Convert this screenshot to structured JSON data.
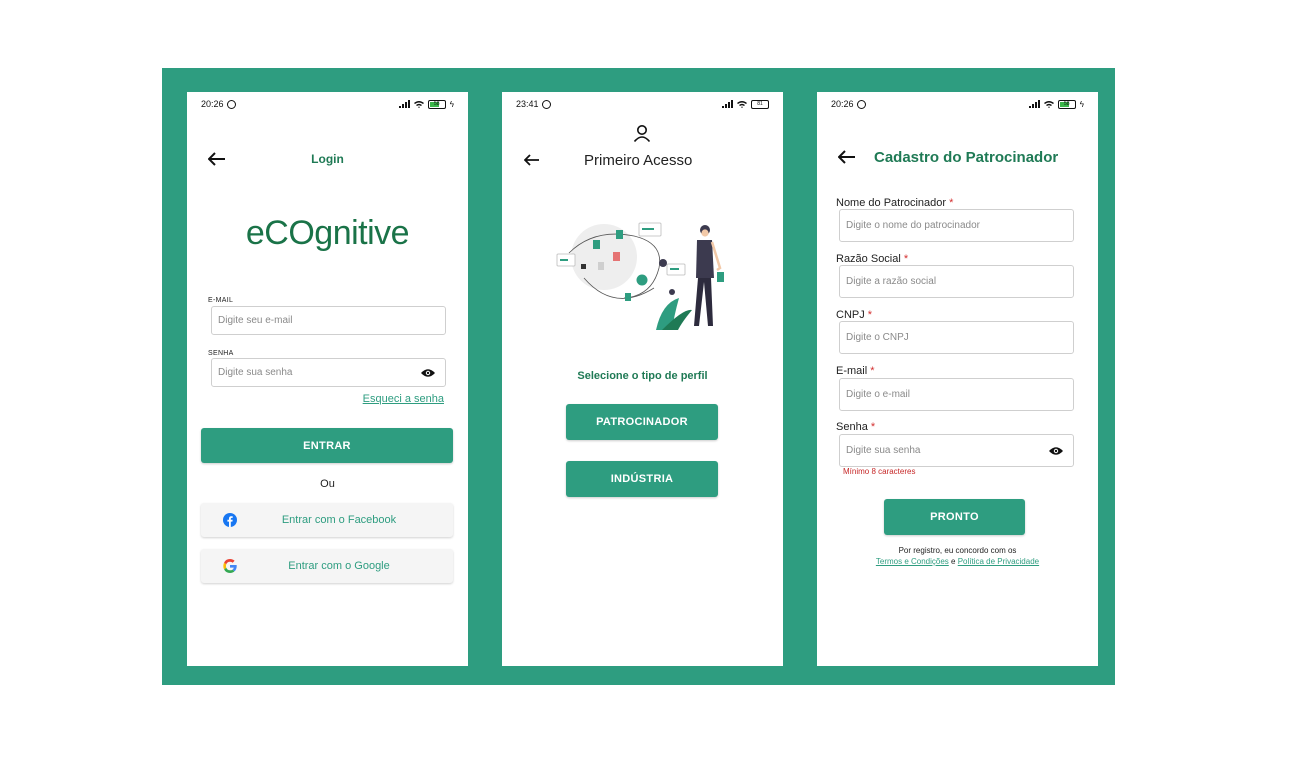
{
  "screens": [
    {
      "status": {
        "time": "20:26",
        "battery": "58"
      },
      "title": "Login",
      "logo": "eCOgnitive",
      "email": {
        "label": "E-MAIL",
        "placeholder": "Digite seu e-mail"
      },
      "password": {
        "label": "SENHA",
        "placeholder": "Digite sua senha"
      },
      "forgot_link": "Esqueci a senha",
      "submit_label": "ENTRAR",
      "or_text": "Ou",
      "facebook_label": "Entrar com o Facebook",
      "google_label": "Entrar com o Google"
    },
    {
      "status": {
        "time": "23:41",
        "battery": "81"
      },
      "title": "Primeiro Acesso",
      "select_text": "Selecione o tipo de perfil",
      "options": [
        "PATROCINADOR",
        "INDÚSTRIA"
      ]
    },
    {
      "status": {
        "time": "20:26",
        "battery": "58"
      },
      "title": "Cadastro do Patrocinador",
      "fields": [
        {
          "label": "Nome do Patrocinador",
          "required": "*",
          "placeholder": "Digite o nome do patrocinador"
        },
        {
          "label": "Razão Social",
          "required": "*",
          "placeholder": "Digite a razão social"
        },
        {
          "label": "CNPJ",
          "required": "*",
          "placeholder": "Digite o CNPJ"
        },
        {
          "label": "E-mail",
          "required": "*",
          "placeholder": "Digite o e-mail"
        },
        {
          "label": "Senha",
          "required": "*",
          "placeholder": "Digite sua senha"
        }
      ],
      "password_hint": "Mínimo 8 caracteres",
      "submit_label": "PRONTO",
      "terms": {
        "prefix": "Por registro, eu concordo com os",
        "terms_link": "Termos e Condições",
        "conjunction": "e",
        "privacy_link": "Política de Privacidade"
      }
    }
  ],
  "colors": {
    "brand": "#2e9d80",
    "title_green": "#1f7a55",
    "error": "#c62828"
  }
}
